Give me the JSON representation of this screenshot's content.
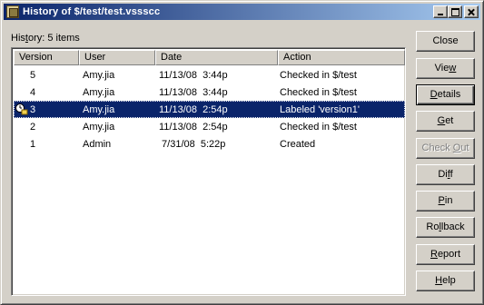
{
  "window": {
    "title": "History of $/test/test.vssscc"
  },
  "history": {
    "label_prefix": "His",
    "label_accel": "t",
    "label_suffix": "ory: 5 items"
  },
  "columns": [
    "Version",
    "User",
    "Date",
    "Action"
  ],
  "rows": [
    {
      "version": "5",
      "user": "Amy.jia",
      "date": "11/13/08  3:44p",
      "action": "Checked in $/test",
      "selected": false
    },
    {
      "version": "4",
      "user": "Amy.jia",
      "date": "11/13/08  3:44p",
      "action": "Checked in $/test",
      "selected": false
    },
    {
      "version": "3",
      "user": "Amy.jia",
      "date": "11/13/08  2:54p",
      "action": "Labeled 'version1'",
      "selected": true
    },
    {
      "version": "2",
      "user": "Amy.jia",
      "date": "11/13/08  2:54p",
      "action": "Checked in $/test",
      "selected": false
    },
    {
      "version": "1",
      "user": "Admin",
      "date": " 7/31/08  5:22p",
      "action": "Created",
      "selected": false
    }
  ],
  "buttons": {
    "close": {
      "pre": "Close",
      "accel": "",
      "post": ""
    },
    "view": {
      "pre": "Vie",
      "accel": "w",
      "post": ""
    },
    "details": {
      "pre": "",
      "accel": "D",
      "post": "etails"
    },
    "get": {
      "pre": "",
      "accel": "G",
      "post": "et"
    },
    "checkout": {
      "pre": "Check ",
      "accel": "O",
      "post": "ut"
    },
    "diff": {
      "pre": "Di",
      "accel": "f",
      "post": "f"
    },
    "pin": {
      "pre": "",
      "accel": "P",
      "post": "in"
    },
    "rollback": {
      "pre": "Ro",
      "accel": "l",
      "post": "lback"
    },
    "report": {
      "pre": "",
      "accel": "R",
      "post": "eport"
    },
    "help": {
      "pre": "",
      "accel": "H",
      "post": "elp"
    }
  },
  "colors": {
    "titlebar_start": "#0a246a",
    "titlebar_end": "#a6caf0",
    "selection": "#0a246a",
    "face": "#d4d0c8"
  }
}
